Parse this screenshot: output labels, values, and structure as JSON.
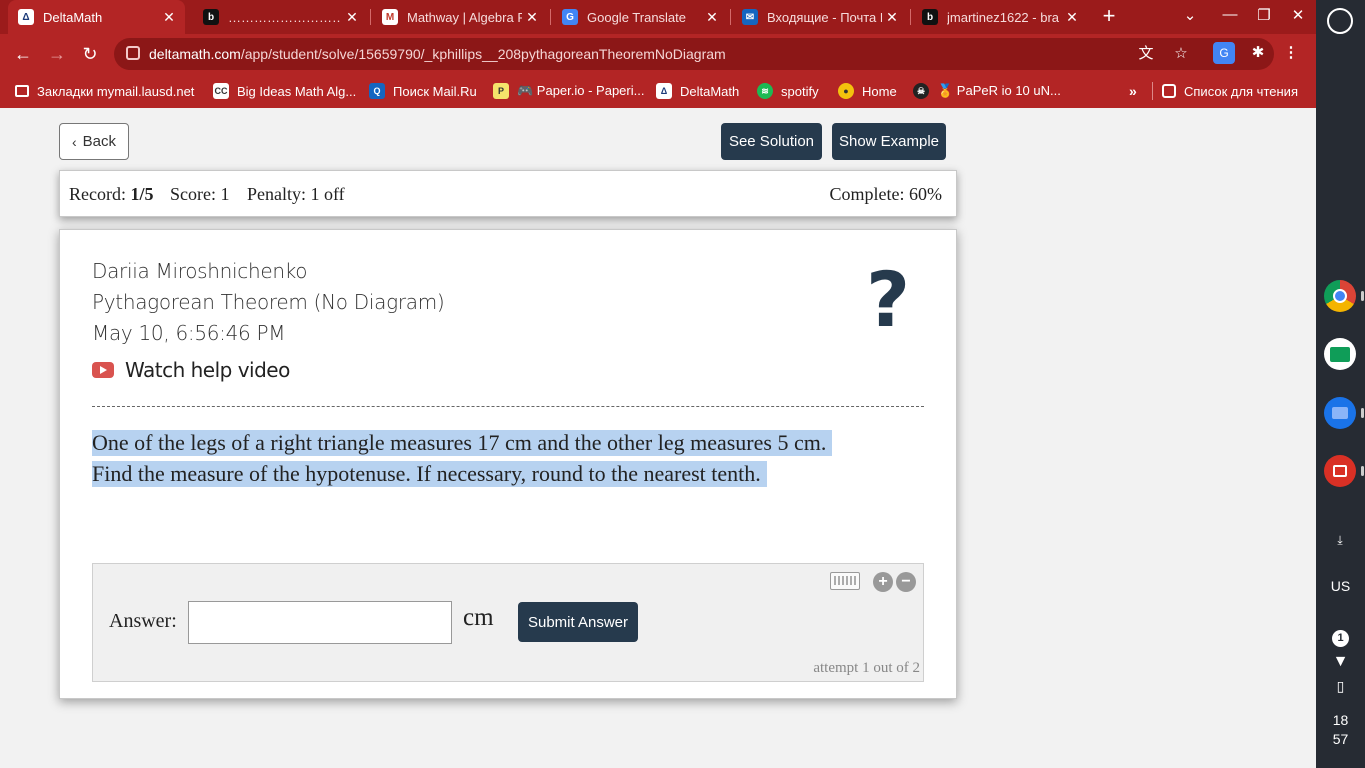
{
  "browser": {
    "tabs": [
      {
        "title": "DeltaMath",
        "icon": "deltamath-icon",
        "active": true
      },
      {
        "title": "……………………………",
        "icon": "brainly-icon",
        "active": false
      },
      {
        "title": "Mathway | Algebra P",
        "icon": "mathway-icon",
        "active": false
      },
      {
        "title": "Google Translate",
        "icon": "google-translate-icon",
        "active": false
      },
      {
        "title": "Входящие - Почта М",
        "icon": "mail-icon",
        "active": false
      },
      {
        "title": "jmartinez1622 - bra",
        "icon": "brainly-icon",
        "active": false
      }
    ],
    "url_host": "deltamath.com",
    "url_path": "/app/student/solve/15659790/_kphillips__208pythagoreanTheoremNoDiagram",
    "bookmarks": [
      {
        "label": "Закладки mymail.lausd.net",
        "icon": "folder-icon"
      },
      {
        "label": "Big Ideas Math Alg...",
        "icon": "bigideas-icon"
      },
      {
        "label": "Поиск Mail.Ru",
        "icon": "search-icon"
      },
      {
        "label": "🎮 Paper.io - Paperi...",
        "icon": "paperio-icon"
      },
      {
        "label": "DeltaMath",
        "icon": "deltamath-icon"
      },
      {
        "label": "spotify",
        "icon": "spotify-icon"
      },
      {
        "label": "Home",
        "icon": "home-icon"
      },
      {
        "label": "🏅 PaPeR io 10 uN...",
        "icon": "pirate-icon"
      }
    ],
    "bookmarks_more": "»",
    "reading_list": "Список для чтения",
    "accent": "#b32525"
  },
  "shelf": {
    "keyboard_layout": "US",
    "notification_count": "1",
    "time_hour": "18",
    "time_min": "57"
  },
  "header": {
    "back_label": "Back",
    "see_solution_label": "See Solution",
    "show_example_label": "Show Example"
  },
  "record": {
    "record_label": "Record:",
    "record_value": "1/5",
    "score": "Score: 1",
    "penalty": "Penalty: 1 off",
    "complete": "Complete: 60%"
  },
  "problem": {
    "student_name": "Dariia Miroshnichenko",
    "assignment": "Pythagorean Theorem (No Diagram)",
    "timestamp": "May 10, 6:56:46 PM",
    "help_video_label": "Watch help video",
    "help_mark": "?",
    "question_line1": "One of the legs of a right triangle measures 17 cm and the other leg measures 5 cm.",
    "question_line2": "Find the measure of the hypotenuse. If necessary, round to the nearest tenth."
  },
  "answer": {
    "label": "Answer:",
    "value": "",
    "unit": "cm",
    "submit_label": "Submit Answer",
    "attempt_text": "attempt 1 out of 2"
  }
}
